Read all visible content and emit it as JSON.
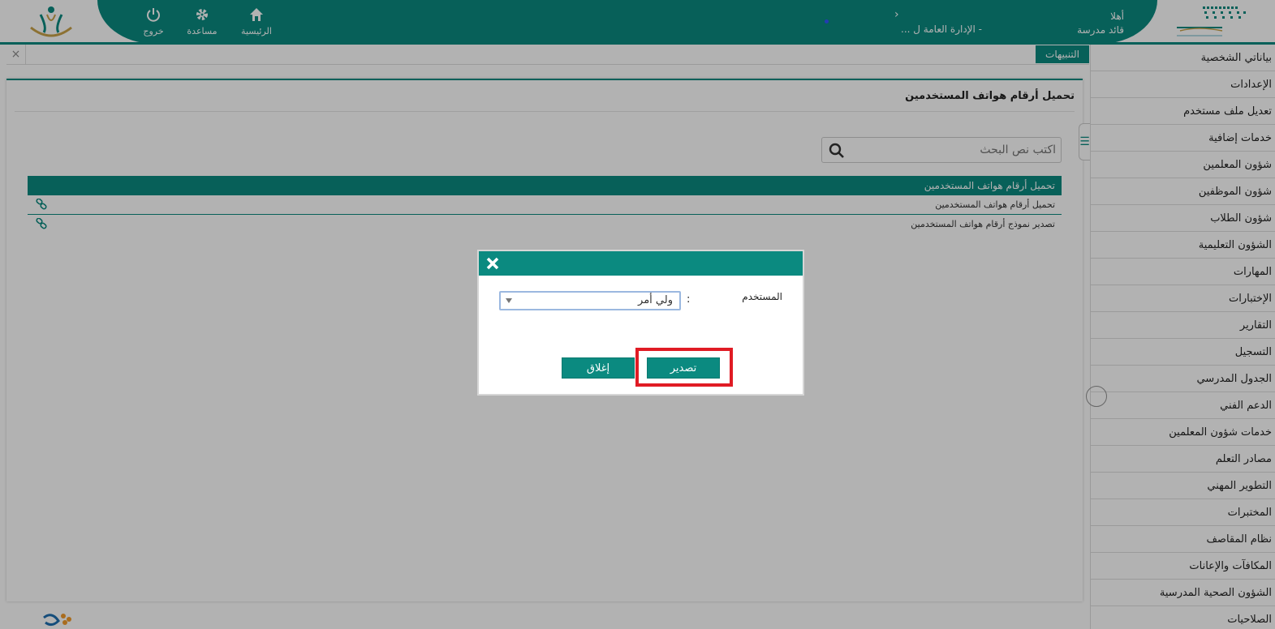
{
  "header": {
    "nav": [
      {
        "label": "الرئيسية",
        "icon": "home-icon"
      },
      {
        "label": "مساعدة",
        "icon": "gear-icon"
      },
      {
        "label": "خروج",
        "icon": "power-icon"
      }
    ],
    "welcome": "أهلا",
    "user_role": "قائد مدرسة",
    "org": "... الإدارة العامة ل -",
    "brand_color": "#0b8a80"
  },
  "tabs": {
    "alerts_label": "التنبيهات",
    "close_symbol": "×"
  },
  "main": {
    "title": "تحميل أرقام هواتف المستخدمين",
    "search_placeholder": "اكتب نص البحث",
    "grid": {
      "header": "تحميل أرقام هواتف المستخدمين",
      "rows": [
        "تحميل أرقام هواتف المستخدمين",
        "تصدير نموذج أرقام هواتف المستخدمين"
      ]
    }
  },
  "sidebar": {
    "toggle_symbol": "☰",
    "items": [
      "بياناتي الشخصية",
      "الإعدادات",
      "تعديل ملف مستخدم",
      "خدمات إضافية",
      "شؤون المعلمين",
      "شؤون الموظفين",
      "شؤون الطلاب",
      "الشؤون التعليمية",
      "المهارات",
      "الإختبارات",
      "التقارير",
      "التسجيل",
      "الجدول المدرسي",
      "الدعم الفني",
      "خدمات شؤون المعلمين",
      "مصادر التعلم",
      "التطوير المهني",
      "المختبرات",
      "نظام المقاصف",
      "المكافآت والإعانات",
      "الشؤون الصحية المدرسية",
      "الصلاحيات"
    ]
  },
  "dialog": {
    "field_label": "المستخدم",
    "colon": ":",
    "selected_value": "ولي أمر",
    "export_label": "تصدير",
    "close_label": "إغلاق",
    "highlight_color": "#e01b24"
  }
}
